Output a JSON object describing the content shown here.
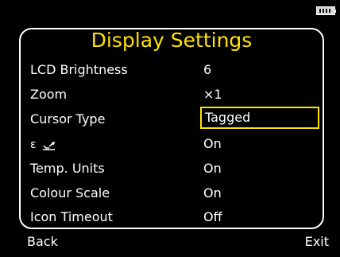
{
  "title": "Display Settings",
  "settings": [
    {
      "label": "LCD Brightness",
      "value": "6"
    },
    {
      "label": "Zoom",
      "value": "×1"
    },
    {
      "label": "Cursor Type",
      "value": "Tagged",
      "selected": true
    },
    {
      "label": "",
      "icon": "emissivity-icon",
      "value": "On"
    },
    {
      "label": "Temp. Units",
      "value": "On"
    },
    {
      "label": "Colour Scale",
      "value": "On"
    },
    {
      "label": "Icon Timeout",
      "value": "Off"
    }
  ],
  "footer": {
    "left": "Back",
    "right": "Exit"
  },
  "colors": {
    "accent": "#ffe100",
    "text": "#ffffff",
    "background": "#000000"
  },
  "status": {
    "battery_icon": "battery-icon"
  }
}
